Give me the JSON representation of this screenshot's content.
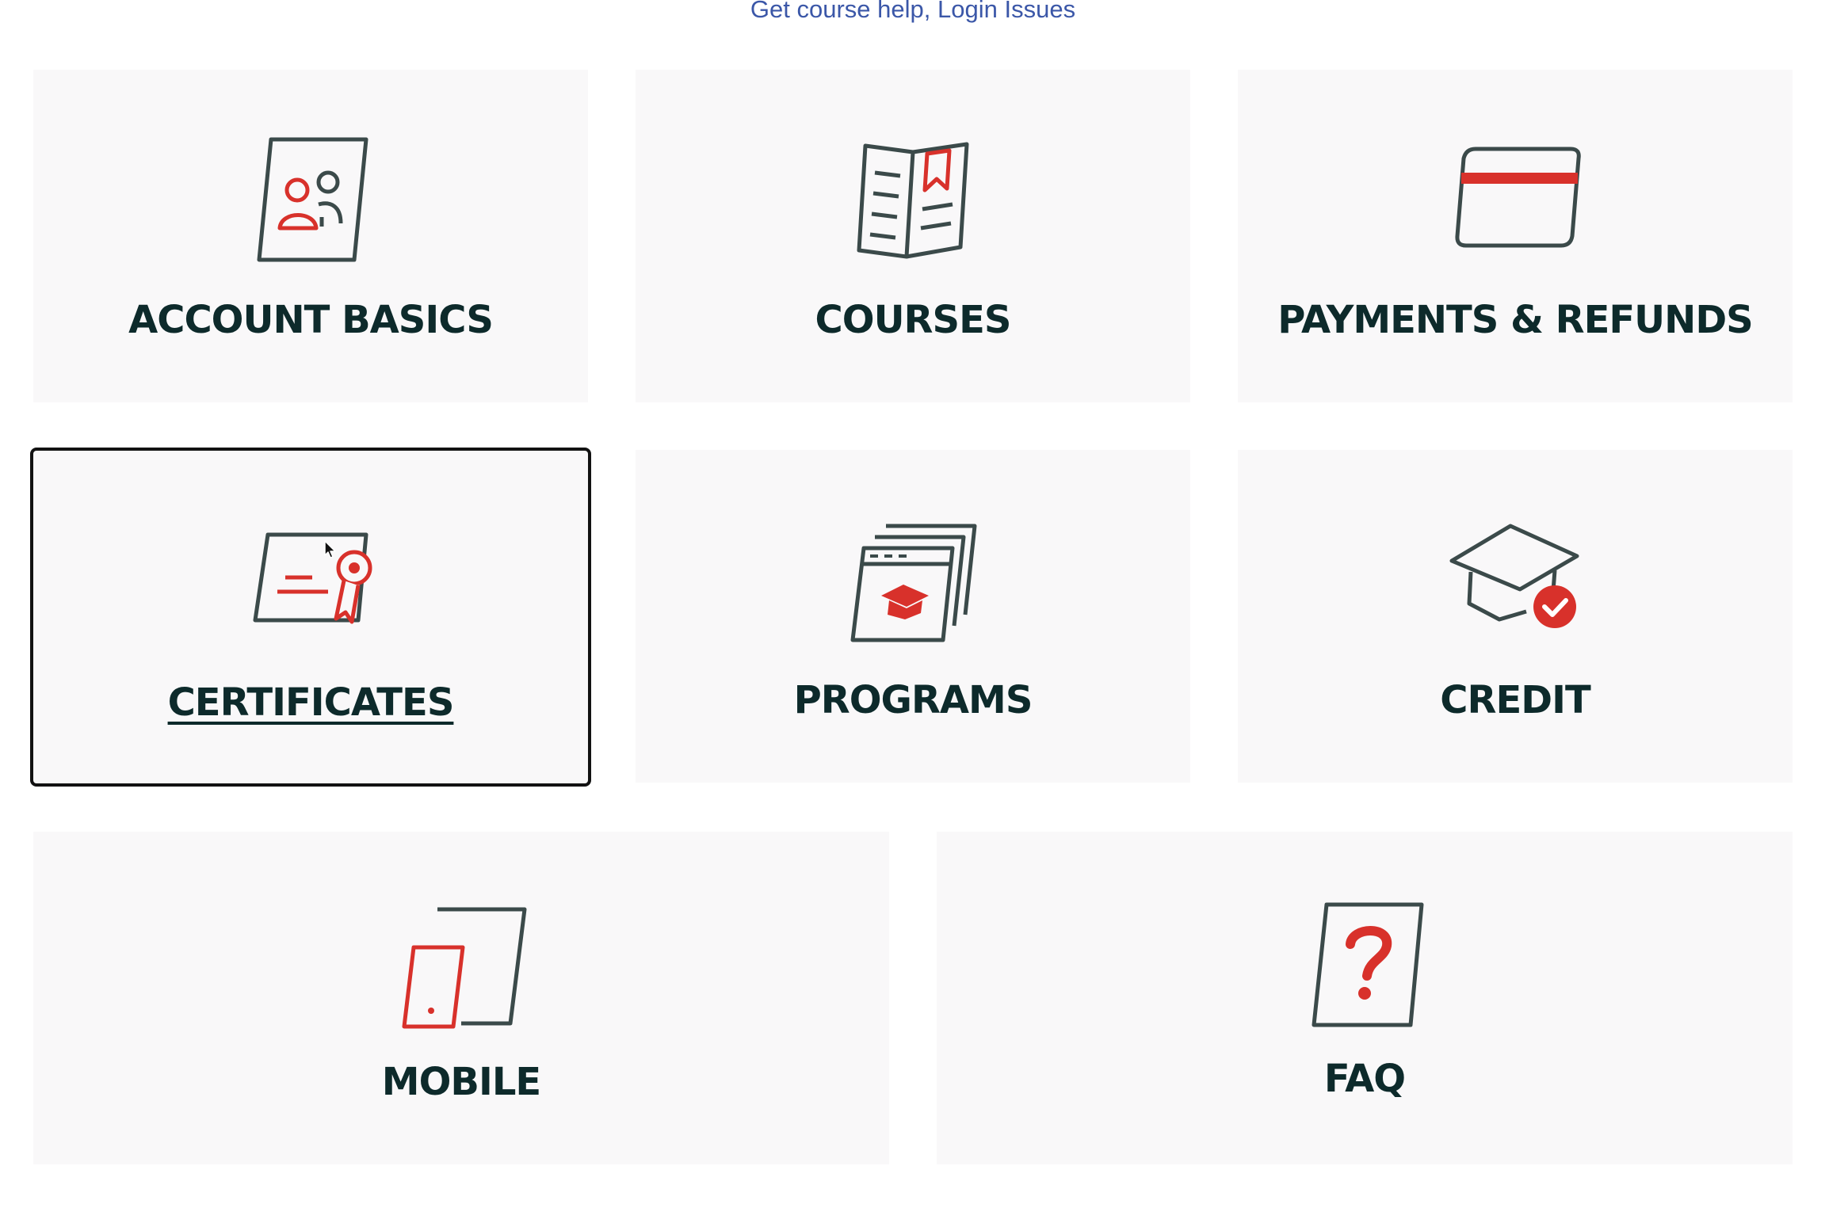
{
  "header": {
    "link_course_help": "Get course help",
    "separator": ", ",
    "link_login_issues": "Login Issues"
  },
  "colors": {
    "accent_red": "#d8312b",
    "icon_dark": "#3b4a4a",
    "link_blue": "#3b57a8",
    "label_dark": "#0d2a2b",
    "card_bg": "#f9f8f9"
  },
  "categories": [
    {
      "label": "ACCOUNT BASICS",
      "icon": "account-people-icon"
    },
    {
      "label": "COURSES",
      "icon": "open-book-icon"
    },
    {
      "label": "PAYMENTS & REFUNDS",
      "icon": "credit-card-icon"
    },
    {
      "label": "CERTIFICATES",
      "icon": "certificate-ribbon-icon",
      "focused": true
    },
    {
      "label": "PROGRAMS",
      "icon": "program-window-cap-icon"
    },
    {
      "label": "CREDIT",
      "icon": "graduation-cap-check-icon"
    },
    {
      "label": "MOBILE",
      "icon": "mobile-tablet-icon"
    },
    {
      "label": "FAQ",
      "icon": "question-document-icon"
    }
  ]
}
